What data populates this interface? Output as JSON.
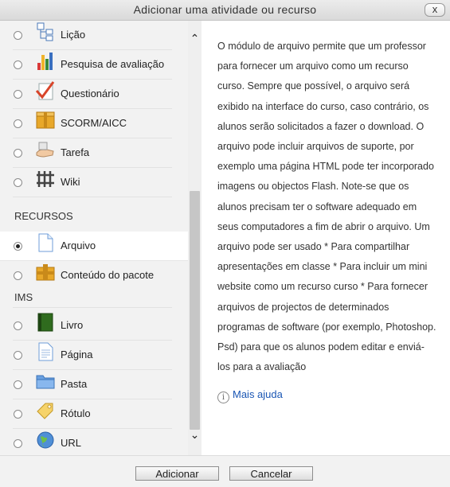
{
  "dialog": {
    "title": "Adicionar uma atividade ou recurso",
    "close_label": "x"
  },
  "activities": [
    {
      "label": "Lição",
      "icon": "lesson-icon"
    },
    {
      "label": "Pesquisa de avaliação",
      "icon": "survey-icon"
    },
    {
      "label": "Questionário",
      "icon": "quiz-icon"
    },
    {
      "label": "SCORM/AICC",
      "icon": "scorm-icon"
    },
    {
      "label": "Tarefa",
      "icon": "assignment-icon"
    },
    {
      "label": "Wiki",
      "icon": "wiki-icon"
    }
  ],
  "resources_heading": "RECURSOS",
  "resources": [
    {
      "label": "Arquivo",
      "icon": "file-icon",
      "selected": true
    },
    {
      "label_line1": "Conteúdo do pacote",
      "label_line2": "IMS",
      "icon": "ims-package-icon"
    },
    {
      "label": "Livro",
      "icon": "book-icon"
    },
    {
      "label": "Página",
      "icon": "page-icon"
    },
    {
      "label": "Pasta",
      "icon": "folder-icon"
    },
    {
      "label": "Rótulo",
      "icon": "label-icon"
    },
    {
      "label": "URL",
      "icon": "url-icon"
    }
  ],
  "description": "O módulo de arquivo permite que um professor para fornecer um arquivo como um recurso curso. Sempre que possível, o arquivo será exibido na interface do curso, caso contrário, os alunos serão solicitados a fazer o download. O arquivo pode incluir arquivos de suporte, por exemplo uma página HTML pode ter incorporado imagens ou objectos Flash. Note-se que os alunos precisam ter o software adequado em seus computadores a fim de abrir o arquivo. Um arquivo pode ser usado * Para compartilhar apresentações em classe * Para incluir um mini website como um recurso curso * Para fornecer arquivos de projectos de determinados programas de software (por exemplo, Photoshop. Psd) para que os alunos podem editar e enviá-los para a avaliação",
  "help_link": "Mais ajuda",
  "buttons": {
    "add": "Adicionar",
    "cancel": "Cancelar"
  }
}
